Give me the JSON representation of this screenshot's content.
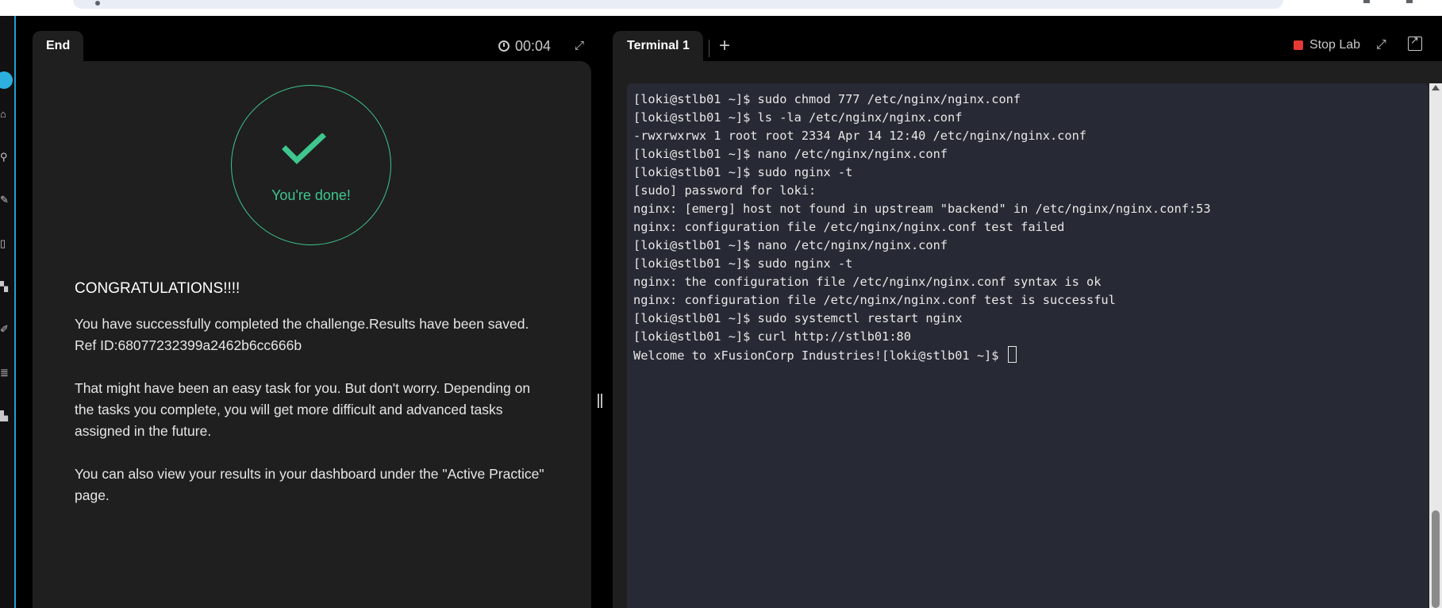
{
  "left_panel": {
    "tab_label": "End",
    "timer": "00:04",
    "done_text": "You're done!",
    "congrats": "CONGRATULATIONS!!!!",
    "message_1": "You have successfully completed the challenge.Results have been saved. Ref ID:68077232399a2462b6cc666b",
    "message_2": "That might have been an easy task for you. But don't worry. Depending on the tasks you complete, you will get more difficult and advanced tasks assigned in the future.",
    "message_3": "You can also view your results in your dashboard under the \"Active Practice\" page."
  },
  "terminal": {
    "tab_label": "Terminal 1",
    "add_tab_label": "+",
    "stop_lab_label": "Stop Lab",
    "lines": [
      "[loki@stlb01 ~]$ sudo chmod 777 /etc/nginx/nginx.conf",
      "[loki@stlb01 ~]$ ls -la /etc/nginx/nginx.conf",
      "-rwxrwxrwx 1 root root 2334 Apr 14 12:40 /etc/nginx/nginx.conf",
      "[loki@stlb01 ~]$ nano /etc/nginx/nginx.conf",
      "[loki@stlb01 ~]$ sudo nginx -t",
      "[sudo] password for loki:",
      "nginx: [emerg] host not found in upstream \"backend\" in /etc/nginx/nginx.conf:53",
      "nginx: configuration file /etc/nginx/nginx.conf test failed",
      "[loki@stlb01 ~]$ nano /etc/nginx/nginx.conf",
      "[loki@stlb01 ~]$ sudo nginx -t",
      "nginx: the configuration file /etc/nginx/nginx.conf syntax is ok",
      "nginx: configuration file /etc/nginx/nginx.conf test is successful",
      "[loki@stlb01 ~]$ sudo systemctl restart nginx",
      "[loki@stlb01 ~]$ curl http://stlb01:80",
      "Welcome to xFusionCorp Industries![loki@stlb01 ~]$ "
    ]
  },
  "icons": {
    "timer": "stopwatch-icon",
    "expand": "expand-icon",
    "popout": "external-link-icon",
    "stop": "stop-square-icon",
    "check": "checkmark-icon"
  },
  "colors": {
    "success": "#3fc68e",
    "stop": "#e53935",
    "sidebar_accent": "#1f9fd6"
  }
}
